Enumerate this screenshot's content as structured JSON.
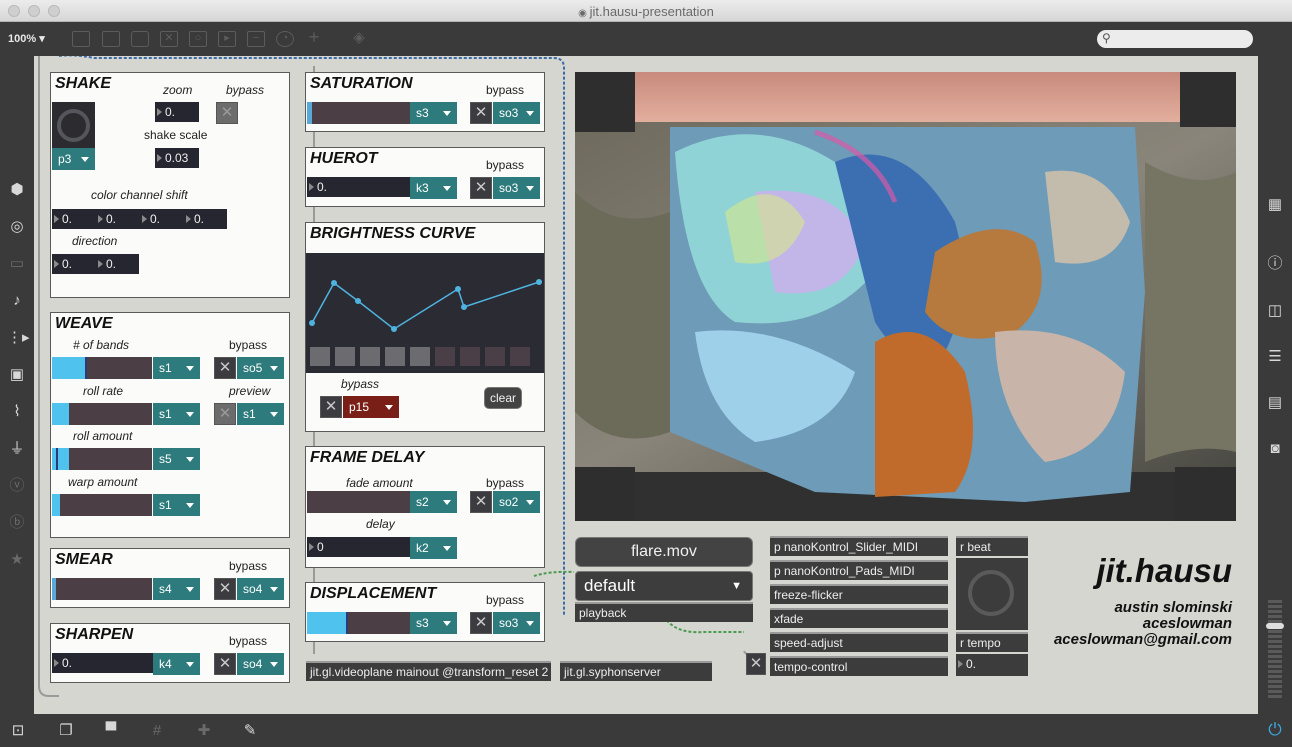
{
  "window": {
    "title": "jit.hausu-presentation"
  },
  "toolbar": {
    "zoom": "100%",
    "zoom_arrow": "▾"
  },
  "search": {
    "icon": "⚲"
  },
  "shake": {
    "title": "SHAKE",
    "zoom_label": "zoom",
    "zoom_value": "0.",
    "bypass_label": "bypass",
    "shake_scale_label": "shake scale",
    "shake_scale_value": "0.03",
    "preset": "p3",
    "color_shift_label": "color channel shift",
    "color_shift_values": [
      "0.",
      "0.",
      "0.",
      "0."
    ],
    "direction_label": "direction",
    "direction_values": [
      "0.",
      "0."
    ]
  },
  "weave": {
    "title": "WEAVE",
    "bands_label": "# of bands",
    "bands_menu": "s1",
    "bands_fill": 0.35,
    "bypass_label": "bypass",
    "bypass_menu": "so5",
    "roll_rate_label": "roll rate",
    "roll_rate_menu": "s1",
    "roll_rate_fill": 0.17,
    "preview_label": "preview",
    "preview_menu": "s1",
    "roll_amount_label": "roll amount",
    "roll_amount_menu": "s5",
    "roll_amount_fill": 0.17,
    "warp_amount_label": "warp amount",
    "warp_amount_menu": "s1",
    "warp_amount_fill": 0.08
  },
  "smear": {
    "title": "SMEAR",
    "menu": "s4",
    "bypass_label": "bypass",
    "bypass_menu": "so4"
  },
  "sharpen": {
    "title": "SHARPEN",
    "value": "0.",
    "menu": "k4",
    "bypass_label": "bypass",
    "bypass_menu": "so4"
  },
  "saturation": {
    "title": "SATURATION",
    "menu": "s3",
    "bypass_label": "bypass",
    "bypass_menu": "so3"
  },
  "huerot": {
    "title": "HUEROT",
    "value": "0.",
    "menu": "k3",
    "bypass_label": "bypass",
    "bypass_menu": "so3"
  },
  "brightness": {
    "title": "BRIGHTNESS CURVE",
    "bypass_label": "bypass",
    "preset": "p15",
    "clear_label": "clear"
  },
  "frame_delay": {
    "title": "FRAME DELAY",
    "fade_label": "fade amount",
    "fade_menu": "s2",
    "fade_fill": 0.0,
    "bypass_label": "bypass",
    "bypass_menu": "so2",
    "delay_label": "delay",
    "delay_value": "0",
    "delay_menu": "k2"
  },
  "displacement": {
    "title": "DISPLACEMENT",
    "menu": "s3",
    "fill": 0.4,
    "bypass_label": "bypass",
    "bypass_menu": "so3"
  },
  "objects": {
    "videoplane": "jit.gl.videoplane mainout @transform_reset 2",
    "syphon": "jit.gl.syphonserver",
    "playback": "playback",
    "nano_slider": "p nanoKontrol_Slider_MIDI",
    "nano_pads": "p nanoKontrol_Pads_MIDI",
    "freeze": "freeze-flicker",
    "xfade": "xfade",
    "speed": "speed-adjust",
    "tempo_control": "tempo-control",
    "r_beat": "r beat",
    "r_tempo": "r tempo",
    "tempo_value": "0."
  },
  "movie": {
    "file": "flare.mov",
    "dropdown": "default"
  },
  "credits": {
    "app": "jit.hausu",
    "name": "austin slominski",
    "handle": "aceslowman",
    "email": "aceslowman@gmail.com"
  },
  "colors": {
    "teal": "#2d7b7c",
    "slider_fill": "#4fc3ee",
    "dark": "#262630",
    "canvas": "#d6d6d0"
  }
}
